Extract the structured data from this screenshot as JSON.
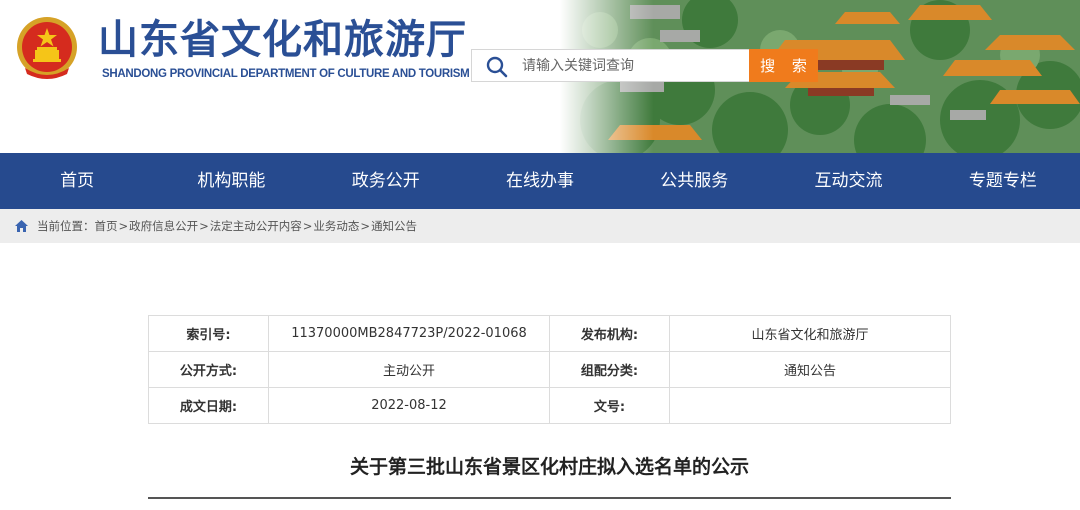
{
  "header": {
    "title": "山东省文化和旅游厅",
    "subtitle": "SHANDONG PROVINCIAL DEPARTMENT OF CULTURE AND TOURISM",
    "emblem_icon": "national-emblem-icon",
    "scenery_image": "temple-rooftops-illustration"
  },
  "search": {
    "placeholder": "请输入关键词查询",
    "button_label": "搜 索",
    "icon": "search-icon"
  },
  "nav": {
    "items": [
      {
        "label": "首页"
      },
      {
        "label": "机构职能"
      },
      {
        "label": "政务公开"
      },
      {
        "label": "在线办事"
      },
      {
        "label": "公共服务"
      },
      {
        "label": "互动交流"
      },
      {
        "label": "专题专栏"
      }
    ]
  },
  "breadcrumb": {
    "prefix": "当前位置：",
    "items": [
      "首页",
      "政府信息公开",
      "法定主动公开内容",
      "业务动态",
      "通知公告"
    ],
    "separator": ">"
  },
  "info": {
    "index_label": "索引号:",
    "index_value": "11370000MB2847723P/2022-01068",
    "publisher_label": "发布机构:",
    "publisher_value": "山东省文化和旅游厅",
    "disclosure_label": "公开方式:",
    "disclosure_value": "主动公开",
    "category_label": "组配分类:",
    "category_value": "通知公告",
    "date_label": "成文日期:",
    "date_value": "2022-08-12",
    "docno_label": "文号:",
    "docno_value": ""
  },
  "article": {
    "title": "关于第三批山东省景区化村庄拟入选名单的公示"
  },
  "colors": {
    "brand_blue": "#264a8e",
    "title_blue": "#2a4f95",
    "search_orange": "#f07b1c",
    "breadcrumb_bg": "#ededed"
  }
}
